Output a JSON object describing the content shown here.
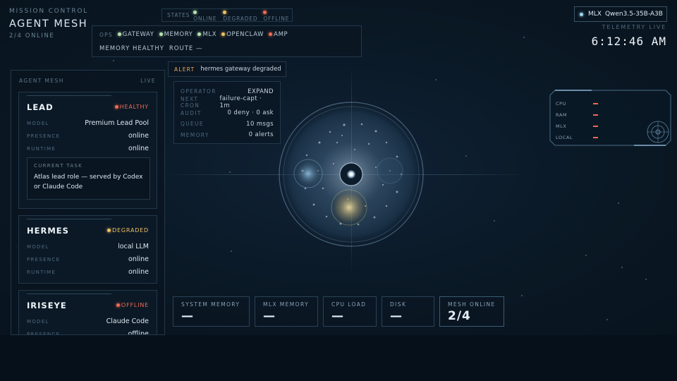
{
  "brand": {
    "kicker": "MISSION CONTROL",
    "title": "AGENT MESH",
    "subtitle": "2/4 ONLINE"
  },
  "states_legend": {
    "label": "STATES",
    "items": [
      {
        "label": "ONLINE",
        "status": "online"
      },
      {
        "label": "DEGRADED",
        "status": "degraded"
      },
      {
        "label": "OFFLINE",
        "status": "offline"
      }
    ]
  },
  "ops": {
    "label": "OPS",
    "services": [
      {
        "label": "GATEWAY",
        "status": "online"
      },
      {
        "label": "MEMORY",
        "status": "online"
      },
      {
        "label": "MLX",
        "status": "online"
      },
      {
        "label": "OPENCLAW",
        "status": "degraded"
      },
      {
        "label": "AMP",
        "status": "offline"
      }
    ],
    "memory_status": "MEMORY HEALTHY",
    "route": "ROUTE —"
  },
  "model_chip": {
    "provider": "MLX",
    "model": "Qwen3.5-35B-A3B"
  },
  "telemetry": {
    "label": "TELEMETRY LIVE",
    "time": "6:12:46 AM"
  },
  "alert": {
    "tag": "ALERT",
    "message": "hermes gateway degraded"
  },
  "status_table": [
    {
      "key": "OPERATOR",
      "value": "EXPAND"
    },
    {
      "key": "NEXT CRON",
      "value": "failure-capt · 1m"
    },
    {
      "key": "AUDIT",
      "value": "0 deny · 0 ask"
    },
    {
      "key": "QUEUE",
      "value": "10 msgs"
    },
    {
      "key": "MEMORY",
      "value": "0 alerts"
    }
  ],
  "sidebar": {
    "title": "AGENT MESH",
    "badge": "LIVE",
    "agents": [
      {
        "name": "LEAD",
        "state": "HEALTHY",
        "fields": [
          {
            "key": "MODEL",
            "value": "Premium Lead Pool"
          },
          {
            "key": "PRESENCE",
            "value": "online"
          },
          {
            "key": "RUNTIME",
            "value": "online"
          }
        ],
        "task_label": "CURRENT TASK",
        "task": "Atlas lead role — served by Codex or Claude Code"
      },
      {
        "name": "HERMES",
        "state": "DEGRADED",
        "fields": [
          {
            "key": "MODEL",
            "value": "local LLM"
          },
          {
            "key": "PRESENCE",
            "value": "online"
          },
          {
            "key": "RUNTIME",
            "value": "online"
          }
        ]
      },
      {
        "name": "IRISEYE",
        "state": "OFFLINE",
        "fields": [
          {
            "key": "MODEL",
            "value": "Claude Code"
          },
          {
            "key": "PRESENCE",
            "value": "offline"
          }
        ]
      }
    ]
  },
  "system_widget": {
    "rows": [
      {
        "label": "CPU",
        "value": "—"
      },
      {
        "label": "RAM",
        "value": "—"
      },
      {
        "label": "MLX",
        "value": "—"
      },
      {
        "label": "LOCAL",
        "value": "—"
      }
    ]
  },
  "metrics": [
    {
      "label": "SYSTEM MEMORY",
      "value": "—"
    },
    {
      "label": "MLX MEMORY",
      "value": "—"
    },
    {
      "label": "CPU LOAD",
      "value": "—"
    },
    {
      "label": "DISK",
      "value": "—"
    },
    {
      "label": "MESH ONLINE",
      "value": "2/4"
    }
  ],
  "colors": {
    "online": "#b7e4b0",
    "degraded": "#f0c063",
    "offline": "#f06a55",
    "background": "#08121c",
    "border": "#22384a"
  },
  "icons": {
    "status_dot": "status-dot-icon",
    "orb": "agent-orb-icon",
    "radar": "radar-icon"
  }
}
